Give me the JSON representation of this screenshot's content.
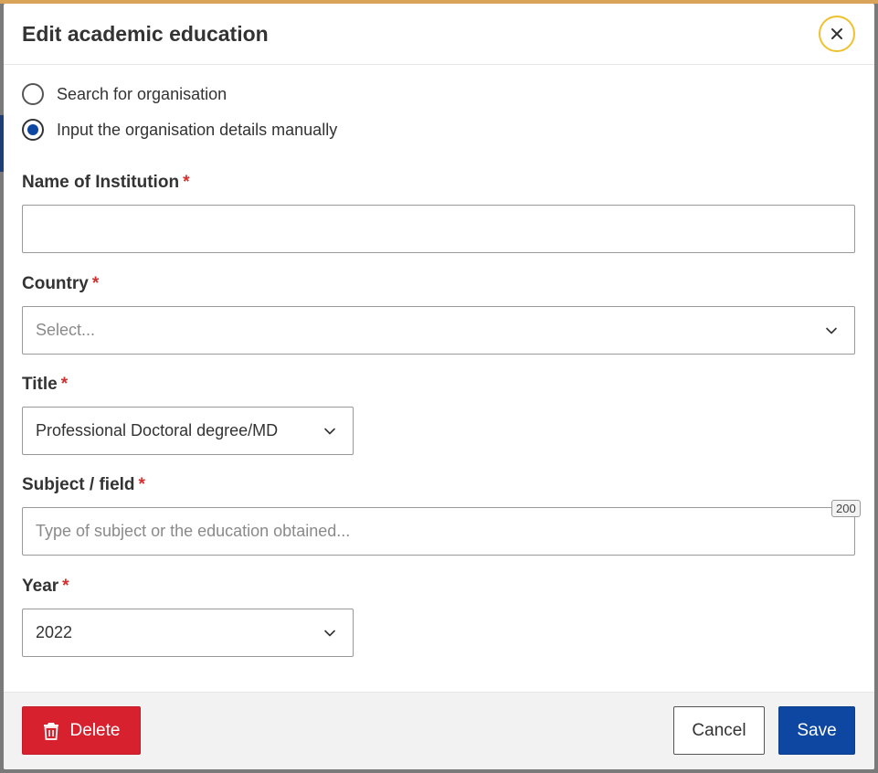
{
  "modal": {
    "title": "Edit academic education",
    "close_icon": "close-icon"
  },
  "options": {
    "search": {
      "label": "Search for organisation",
      "checked": false
    },
    "manual": {
      "label": "Input the organisation details manually",
      "checked": true
    }
  },
  "fields": {
    "institution": {
      "label": "Name of Institution",
      "required": "*",
      "value": ""
    },
    "country": {
      "label": "Country",
      "required": "*",
      "placeholder": "Select..."
    },
    "title": {
      "label": "Title",
      "required": "*",
      "value": "Professional Doctoral degree/MD"
    },
    "subject": {
      "label": "Subject / field",
      "required": "*",
      "placeholder": "Type of subject or the education obtained...",
      "counter": "200"
    },
    "year": {
      "label": "Year",
      "required": "*",
      "value": "2022"
    }
  },
  "footer": {
    "delete_label": "Delete",
    "cancel_label": "Cancel",
    "save_label": "Save"
  },
  "colors": {
    "primary": "#0e47a1",
    "danger": "#d7212f",
    "required": "#d32f2f",
    "close_ring": "#f0c12e"
  }
}
